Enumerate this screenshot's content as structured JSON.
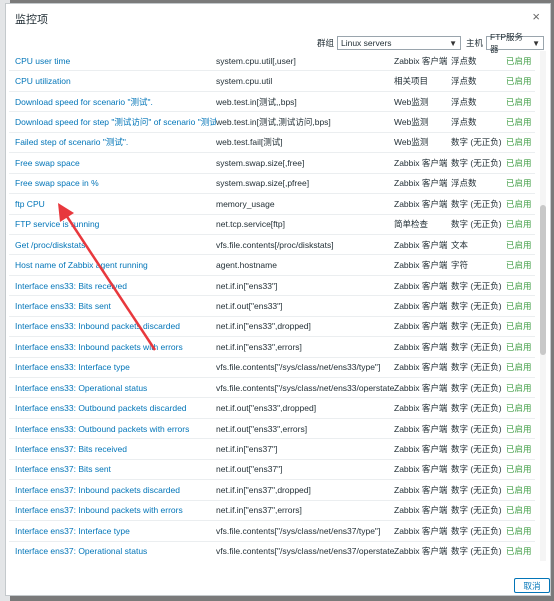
{
  "dialog": {
    "title": "监控项",
    "close_glyph": "×",
    "filter": {
      "group_label": "群组",
      "group_value": "Linux servers",
      "host_label": "主机",
      "host_value": "FTP服务器"
    },
    "cancel_label": "取消"
  },
  "items": [
    {
      "name": "CPU user time",
      "key": "system.cpu.util[,user]",
      "type": "Zabbix 客户端",
      "value_type": "浮点数",
      "status": "已启用"
    },
    {
      "name": "CPU utilization",
      "key": "system.cpu.util",
      "type": "相关项目",
      "value_type": "浮点数",
      "status": "已启用"
    },
    {
      "name": "Download speed for scenario \"测试\".",
      "key": "web.test.in[测试,,bps]",
      "type": "Web监测",
      "value_type": "浮点数",
      "status": "已启用"
    },
    {
      "name": "Download speed for step \"测试访问\" of scenario \"测试\".",
      "key": "web.test.in[测试,测试访问,bps]",
      "type": "Web监测",
      "value_type": "浮点数",
      "status": "已启用"
    },
    {
      "name": "Failed step of scenario \"测试\".",
      "key": "web.test.fail[测试]",
      "type": "Web监测",
      "value_type": "数字 (无正负)",
      "status": "已启用"
    },
    {
      "name": "Free swap space",
      "key": "system.swap.size[,free]",
      "type": "Zabbix 客户端",
      "value_type": "数字 (无正负)",
      "status": "已启用"
    },
    {
      "name": "Free swap space in %",
      "key": "system.swap.size[,pfree]",
      "type": "Zabbix 客户端",
      "value_type": "浮点数",
      "status": "已启用"
    },
    {
      "name": "ftp CPU",
      "key": "memory_usage",
      "type": "Zabbix 客户端",
      "value_type": "数字 (无正负)",
      "status": "已启用"
    },
    {
      "name": "FTP service is running",
      "key": "net.tcp.service[ftp]",
      "type": "简单检查",
      "value_type": "数字 (无正负)",
      "status": "已启用"
    },
    {
      "name": "Get /proc/diskstats",
      "key": "vfs.file.contents[/proc/diskstats]",
      "type": "Zabbix 客户端",
      "value_type": "文本",
      "status": "已启用"
    },
    {
      "name": "Host name of Zabbix agent running",
      "key": "agent.hostname",
      "type": "Zabbix 客户端",
      "value_type": "字符",
      "status": "已启用"
    },
    {
      "name": "Interface ens33: Bits received",
      "key": "net.if.in[\"ens33\"]",
      "type": "Zabbix 客户端",
      "value_type": "数字 (无正负)",
      "status": "已启用"
    },
    {
      "name": "Interface ens33: Bits sent",
      "key": "net.if.out[\"ens33\"]",
      "type": "Zabbix 客户端",
      "value_type": "数字 (无正负)",
      "status": "已启用"
    },
    {
      "name": "Interface ens33: Inbound packets discarded",
      "key": "net.if.in[\"ens33\",dropped]",
      "type": "Zabbix 客户端",
      "value_type": "数字 (无正负)",
      "status": "已启用"
    },
    {
      "name": "Interface ens33: Inbound packets with errors",
      "key": "net.if.in[\"ens33\",errors]",
      "type": "Zabbix 客户端",
      "value_type": "数字 (无正负)",
      "status": "已启用"
    },
    {
      "name": "Interface ens33: Interface type",
      "key": "vfs.file.contents[\"/sys/class/net/ens33/type\"]",
      "type": "Zabbix 客户端",
      "value_type": "数字 (无正负)",
      "status": "已启用"
    },
    {
      "name": "Interface ens33: Operational status",
      "key": "vfs.file.contents[\"/sys/class/net/ens33/operstate\"]",
      "type": "Zabbix 客户端",
      "value_type": "数字 (无正负)",
      "status": "已启用"
    },
    {
      "name": "Interface ens33: Outbound packets discarded",
      "key": "net.if.out[\"ens33\",dropped]",
      "type": "Zabbix 客户端",
      "value_type": "数字 (无正负)",
      "status": "已启用"
    },
    {
      "name": "Interface ens33: Outbound packets with errors",
      "key": "net.if.out[\"ens33\",errors]",
      "type": "Zabbix 客户端",
      "value_type": "数字 (无正负)",
      "status": "已启用"
    },
    {
      "name": "Interface ens37: Bits received",
      "key": "net.if.in[\"ens37\"]",
      "type": "Zabbix 客户端",
      "value_type": "数字 (无正负)",
      "status": "已启用"
    },
    {
      "name": "Interface ens37: Bits sent",
      "key": "net.if.out[\"ens37\"]",
      "type": "Zabbix 客户端",
      "value_type": "数字 (无正负)",
      "status": "已启用"
    },
    {
      "name": "Interface ens37: Inbound packets discarded",
      "key": "net.if.in[\"ens37\",dropped]",
      "type": "Zabbix 客户端",
      "value_type": "数字 (无正负)",
      "status": "已启用"
    },
    {
      "name": "Interface ens37: Inbound packets with errors",
      "key": "net.if.in[\"ens37\",errors]",
      "type": "Zabbix 客户端",
      "value_type": "数字 (无正负)",
      "status": "已启用"
    },
    {
      "name": "Interface ens37: Interface type",
      "key": "vfs.file.contents[\"/sys/class/net/ens37/type\"]",
      "type": "Zabbix 客户端",
      "value_type": "数字 (无正负)",
      "status": "已启用"
    },
    {
      "name": "Interface ens37: Operational status",
      "key": "vfs.file.contents[\"/sys/class/net/ens37/operstate\"]",
      "type": "Zabbix 客户端",
      "value_type": "数字 (无正负)",
      "status": "已启用"
    }
  ],
  "colors": {
    "link": "#0275b8",
    "enabled": "#429e47",
    "annotation_arrow": "#e8383d"
  }
}
